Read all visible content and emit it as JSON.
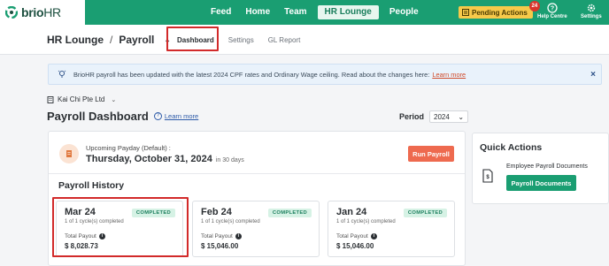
{
  "brand": {
    "name_prefix": "brio",
    "name_suffix": "HR"
  },
  "nav": {
    "items": [
      {
        "label": "Feed"
      },
      {
        "label": "Home"
      },
      {
        "label": "Team"
      },
      {
        "label": "HR Lounge"
      },
      {
        "label": "People"
      }
    ],
    "active": "HR Lounge"
  },
  "pending": {
    "label": "Pending Actions",
    "count": "24"
  },
  "top_actions": {
    "help_label": "Help Centre",
    "settings_label": "Settings"
  },
  "breadcrumb": {
    "root": "HR Lounge",
    "separator": "/",
    "current": "Payroll"
  },
  "subtabs": [
    {
      "label": "Dashboard"
    },
    {
      "label": "Settings"
    },
    {
      "label": "GL Report"
    }
  ],
  "banner": {
    "text": "BrioHR payroll has been updated with the latest 2024 CPF rates and Ordinary Wage ceiling. Read about the changes here:",
    "link": "Learn more",
    "close": "×"
  },
  "company": {
    "name": "Kai Chi Pte Ltd"
  },
  "page": {
    "title": "Payroll Dashboard",
    "learn_more": "Learn more"
  },
  "period": {
    "label": "Period",
    "value": "2024"
  },
  "payday": {
    "label": "Upcoming Payday (Default) :",
    "date": "Thursday, October 31, 2024",
    "days": "in 30 days",
    "run_button": "Run Payroll"
  },
  "history": {
    "title": "Payroll History",
    "cycles": [
      {
        "month": "Mar 24",
        "status": "COMPLETED",
        "sub": "1 of 1 cycle(s) completed",
        "payout_label": "Total Payout",
        "amount": "$ 8,028.73"
      },
      {
        "month": "Feb 24",
        "status": "COMPLETED",
        "sub": "1 of 1 cycle(s) completed",
        "payout_label": "Total Payout",
        "amount": "$ 15,046.00"
      },
      {
        "month": "Jan 24",
        "status": "COMPLETED",
        "sub": "1 of 1 cycle(s) completed",
        "payout_label": "Total Payout",
        "amount": "$ 15,046.00"
      }
    ]
  },
  "quick_actions": {
    "title": "Quick Actions",
    "item_label": "Employee Payroll Documents",
    "item_button": "Payroll Documents"
  },
  "colors": {
    "brand_green": "#1a9e72",
    "highlight_red": "#d22a2a",
    "run_orange": "#ee6a4f",
    "pending_yellow": "#f6c94a"
  },
  "icons": [
    "brand-logo-icon",
    "help-icon",
    "gear-icon",
    "lightbulb-icon",
    "building-icon",
    "chevron-down-icon",
    "info-icon",
    "document-icon",
    "close-icon"
  ]
}
